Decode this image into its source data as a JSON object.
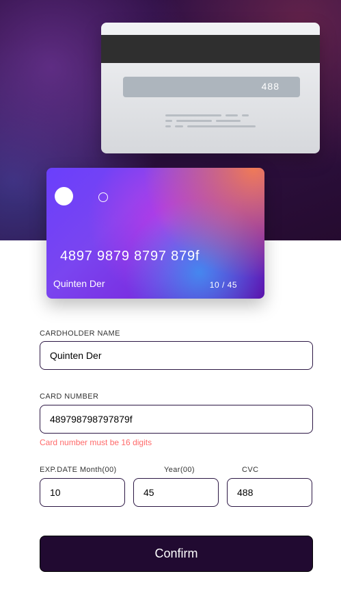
{
  "card_back": {
    "cvc_display": "488"
  },
  "card_front": {
    "number_display": "4897 9879 8797 879f",
    "holder_display": "Quinten Der",
    "expiry_display": "10 / 45"
  },
  "form": {
    "cardholder": {
      "label": "CARDHOLDER NAME",
      "value": "Quinten Der"
    },
    "card_number": {
      "label": "CARD NUMBER",
      "value": "489798798797879f",
      "error": "Card number must be 16 digits"
    },
    "expiry": {
      "month_label": "EXP.DATE Month(00)",
      "month_value": "10",
      "year_label": "Year(00)",
      "year_value": "45"
    },
    "cvc": {
      "label": "CVC",
      "value": "488"
    },
    "confirm_label": "Confirm"
  },
  "colors": {
    "primary_dark": "#210a31",
    "error": "#ff6a6a",
    "input_border": "#2b1643"
  },
  "icons": {
    "card_chip_big": "circle",
    "card_chip_small": "circle-outline"
  }
}
